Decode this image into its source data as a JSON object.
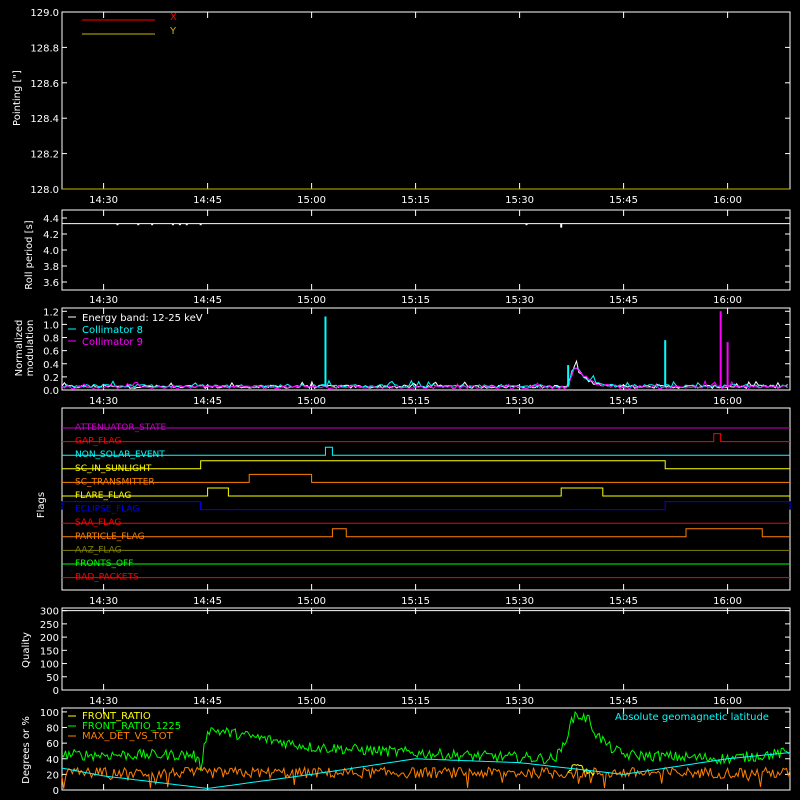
{
  "colors": {
    "background": "#000000",
    "axes": "#ffffff",
    "x_pointing": "#ff0000",
    "y_pointing": "#c8b400",
    "roll_line": "#ffffff",
    "energy": "#ffffff",
    "collimator8": "#00ffff",
    "collimator9": "#ff00ff",
    "front_ratio": "#ffff00",
    "front_ratio_1225": "#00ff00",
    "max_det_vs_tot": "#ff8000",
    "geomag": "#00ffff",
    "quality_line": "#ffffff"
  },
  "time_axis": {
    "range": [
      "14:24",
      "16:09"
    ],
    "ticks": [
      "14:30",
      "14:45",
      "15:00",
      "15:15",
      "15:30",
      "15:45",
      "16:00"
    ]
  },
  "chart_data": [
    {
      "id": "pointing",
      "type": "line",
      "ylabel": "Pointing [\"]",
      "ylim": [
        128.0,
        129.0
      ],
      "yticks": [
        "129.0",
        "128.8",
        "128.6",
        "128.4",
        "128.2",
        "128.0"
      ],
      "legend": [
        "X",
        "Y"
      ],
      "legend_placement": "top-left",
      "series": [
        {
          "name": "X",
          "color_key": "x_pointing",
          "x": [
            "14:24",
            "16:09"
          ],
          "values": [
            128.0,
            128.0
          ]
        },
        {
          "name": "Y",
          "color_key": "y_pointing",
          "x": [
            "14:24",
            "16:09"
          ],
          "values": [
            128.0,
            128.0
          ]
        }
      ]
    },
    {
      "id": "roll",
      "type": "line",
      "ylabel": "Roll period [s]",
      "ylim": [
        3.5,
        4.5
      ],
      "yticks": [
        "4.4",
        "4.2",
        "4.0",
        "3.8",
        "3.6"
      ],
      "series": [
        {
          "color_key": "roll_line",
          "x": [
            "14:24",
            "16:09"
          ],
          "values": [
            4.33,
            4.33
          ]
        }
      ],
      "dips": [
        {
          "x": "14:32",
          "value": 4.31
        },
        {
          "x": "14:35",
          "value": 4.31
        },
        {
          "x": "14:37",
          "value": 4.31
        },
        {
          "x": "14:40",
          "value": 4.31
        },
        {
          "x": "14:41",
          "value": 4.31
        },
        {
          "x": "14:42",
          "value": 4.31
        },
        {
          "x": "14:44",
          "value": 4.31
        },
        {
          "x": "15:31",
          "value": 4.31
        },
        {
          "x": "15:36",
          "value": 4.28
        }
      ]
    },
    {
      "id": "modulation",
      "type": "line",
      "ylabel": "Normalized modulation",
      "ylabel_lines": [
        "Normalized",
        "modulation"
      ],
      "ylim": [
        0,
        1.25
      ],
      "yticks": [
        "1.2",
        "1.0",
        "0.8",
        "0.6",
        "0.4",
        "0.2",
        "0.0"
      ],
      "legend": [
        "Energy band: 12-25 keV",
        "Collimator 8",
        "Collimator 9"
      ],
      "legend_placement": "top-left",
      "baseline": 0.05,
      "bump": {
        "center": "15:38",
        "peak": 0.33
      },
      "spikes": [
        {
          "series": "Collimator 8",
          "x": "15:02",
          "value": 1.12
        },
        {
          "series": "Collimator 8",
          "x": "15:51",
          "value": 0.76
        },
        {
          "series": "Collimator 8",
          "x": "15:37",
          "value": 0.38
        },
        {
          "series": "Collimator 9",
          "x": "15:59",
          "value": 1.2
        },
        {
          "series": "Collimator 9",
          "x": "16:00",
          "value": 0.73
        }
      ]
    },
    {
      "id": "flags",
      "type": "line",
      "ylabel": "Flags",
      "flags": [
        {
          "label": "ATTENUATOR_STATE",
          "color": "#c800c8",
          "high": []
        },
        {
          "label": "GAP_FLAG",
          "color": "#ff0000",
          "high": [
            [
              "15:58",
              "15:59"
            ]
          ]
        },
        {
          "label": "NON_SOLAR_EVENT",
          "color": "#00ffff",
          "high": [
            [
              "15:02",
              "15:03"
            ]
          ]
        },
        {
          "label": "SC_IN_SUNLIGHT",
          "color": "#ffff00",
          "high": [
            [
              "14:44",
              "15:51"
            ]
          ]
        },
        {
          "label": "SC_TRANSMITTER",
          "color": "#ff8000",
          "high": [
            [
              "14:51",
              "15:00"
            ]
          ]
        },
        {
          "label": "FLARE_FLAG",
          "color": "#ffff00",
          "high": [
            [
              "14:45",
              "14:48"
            ],
            [
              "15:36",
              "15:42"
            ]
          ]
        },
        {
          "label": "ECLIPSE_FLAG",
          "color": "#0000ff",
          "high": [
            [
              "14:24",
              "14:44"
            ],
            [
              "15:51",
              "16:09"
            ]
          ]
        },
        {
          "label": "SAA_FLAG",
          "color": "#ff0000",
          "high": []
        },
        {
          "label": "PARTICLE_FLAG",
          "color": "#ff8000",
          "high": [
            [
              "15:03",
              "15:05"
            ],
            [
              "15:54",
              "16:05"
            ]
          ]
        },
        {
          "label": "AAZ_FLAG",
          "color": "#808000",
          "high": []
        },
        {
          "label": "FRONTS_OFF",
          "color": "#00ff00",
          "high": []
        },
        {
          "label": "BAD_PACKETS",
          "color": "#ff0000",
          "high": []
        }
      ]
    },
    {
      "id": "quality",
      "type": "line",
      "ylabel": "Quality",
      "ylim": [
        0,
        310
      ],
      "yticks": [
        "300",
        "250",
        "200",
        "150",
        "100",
        "50",
        "0"
      ],
      "series": [
        {
          "color_key": "quality_line",
          "x": [
            "14:24",
            "16:09"
          ],
          "values": [
            300,
            300
          ]
        }
      ]
    },
    {
      "id": "ratios",
      "type": "line",
      "ylabel": "Degrees or %",
      "ylim": [
        0,
        105
      ],
      "yticks": [
        "100",
        "80",
        "60",
        "40",
        "20",
        "0"
      ],
      "legend": [
        "FRONT_RATIO",
        "FRONT_RATIO_1225",
        "MAX_DET_VS_TOT"
      ],
      "legend_placement": "top-left",
      "annotation": "Absolute geomagnetic latitude",
      "series": [
        {
          "name": "FRONT_RATIO_1225",
          "color_key": "front_ratio_1225",
          "x": [
            "14:24",
            "14:43",
            "14:44",
            "14:45",
            "15:00",
            "15:20",
            "15:35",
            "15:36",
            "15:37",
            "15:38",
            "15:40",
            "15:41",
            "15:43",
            "15:45",
            "16:00",
            "16:09"
          ],
          "values": [
            45,
            45,
            30,
            78,
            55,
            45,
            40,
            50,
            75,
            97,
            90,
            72,
            55,
            45,
            40,
            48
          ]
        },
        {
          "name": "MAX_DET_VS_TOT",
          "color_key": "max_det_vs_tot",
          "x": [
            "14:24",
            "16:09"
          ],
          "values": [
            22,
            22
          ]
        },
        {
          "name": "FRONT_RATIO",
          "color_key": "front_ratio",
          "x": [
            "15:37",
            "15:38",
            "15:39",
            "15:40",
            "15:41"
          ],
          "values": [
            20,
            35,
            28,
            22,
            20
          ]
        },
        {
          "name": "Absolute geomagnetic latitude",
          "color_key": "geomag",
          "x": [
            "14:24",
            "14:30",
            "14:45",
            "15:00",
            "15:15",
            "15:30",
            "15:45",
            "16:00",
            "16:09"
          ],
          "values": [
            28,
            18,
            2,
            20,
            40,
            35,
            20,
            40,
            48
          ]
        }
      ]
    }
  ]
}
